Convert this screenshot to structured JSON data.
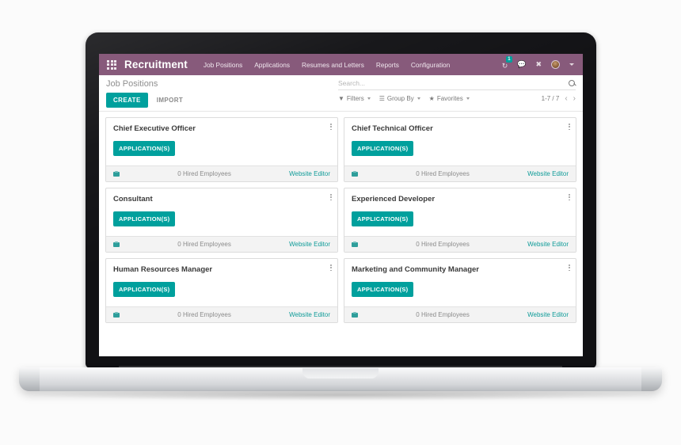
{
  "navbar": {
    "apps_icon": "apps-grid-icon",
    "brand": "Recruitment",
    "menu_items": [
      {
        "label": "Job Positions"
      },
      {
        "label": "Applications"
      },
      {
        "label": "Resumes and Letters"
      },
      {
        "label": "Reports"
      },
      {
        "label": "Configuration"
      }
    ],
    "activity_icon": "clock-activity-icon",
    "activity_badge": "1",
    "messages_icon": "chat-bubble-icon",
    "shortcut_icon": "wrench-icon",
    "avatar_icon": "user-avatar",
    "user_caret_icon": "chevron-down-icon"
  },
  "control_panel": {
    "breadcrumb": "Job Positions",
    "create_label": "CREATE",
    "import_label": "IMPORT",
    "search": {
      "placeholder": "Search...",
      "value": "",
      "icon": "search-icon"
    },
    "filters": [
      {
        "label": "Filters",
        "icon": "funnel-icon"
      },
      {
        "label": "Group By",
        "icon": "list-icon"
      },
      {
        "label": "Favorites",
        "icon": "star-icon"
      }
    ],
    "pager": {
      "range": "1-7 / 7",
      "prev_icon": "chevron-left-icon",
      "next_icon": "chevron-right-icon"
    }
  },
  "kanban": {
    "menu_icon": "kebab-menu-icon",
    "footer_icon": "company-building-icon",
    "cards": [
      {
        "title": "Chief Executive Officer",
        "applications_label": "APPLICATION(S)",
        "hired": "0 Hired Employees",
        "website_link": "Website Editor"
      },
      {
        "title": "Chief Technical Officer",
        "applications_label": "APPLICATION(S)",
        "hired": "0 Hired Employees",
        "website_link": "Website Editor"
      },
      {
        "title": "Consultant",
        "applications_label": "APPLICATION(S)",
        "hired": "0 Hired Employees",
        "website_link": "Website Editor"
      },
      {
        "title": "Experienced Developer",
        "applications_label": "APPLICATION(S)",
        "hired": "0 Hired Employees",
        "website_link": "Website Editor"
      },
      {
        "title": "Human Resources Manager",
        "applications_label": "APPLICATION(S)",
        "hired": "0 Hired Employees",
        "website_link": "Website Editor"
      },
      {
        "title": "Marketing and Community Manager",
        "applications_label": "APPLICATION(S)",
        "hired": "0 Hired Employees",
        "website_link": "Website Editor"
      }
    ]
  },
  "colors": {
    "brand_purple": "#875a7b",
    "accent_teal": "#00a09d",
    "link_teal": "#0e9b98",
    "footer_gray": "#f3f3f3"
  }
}
